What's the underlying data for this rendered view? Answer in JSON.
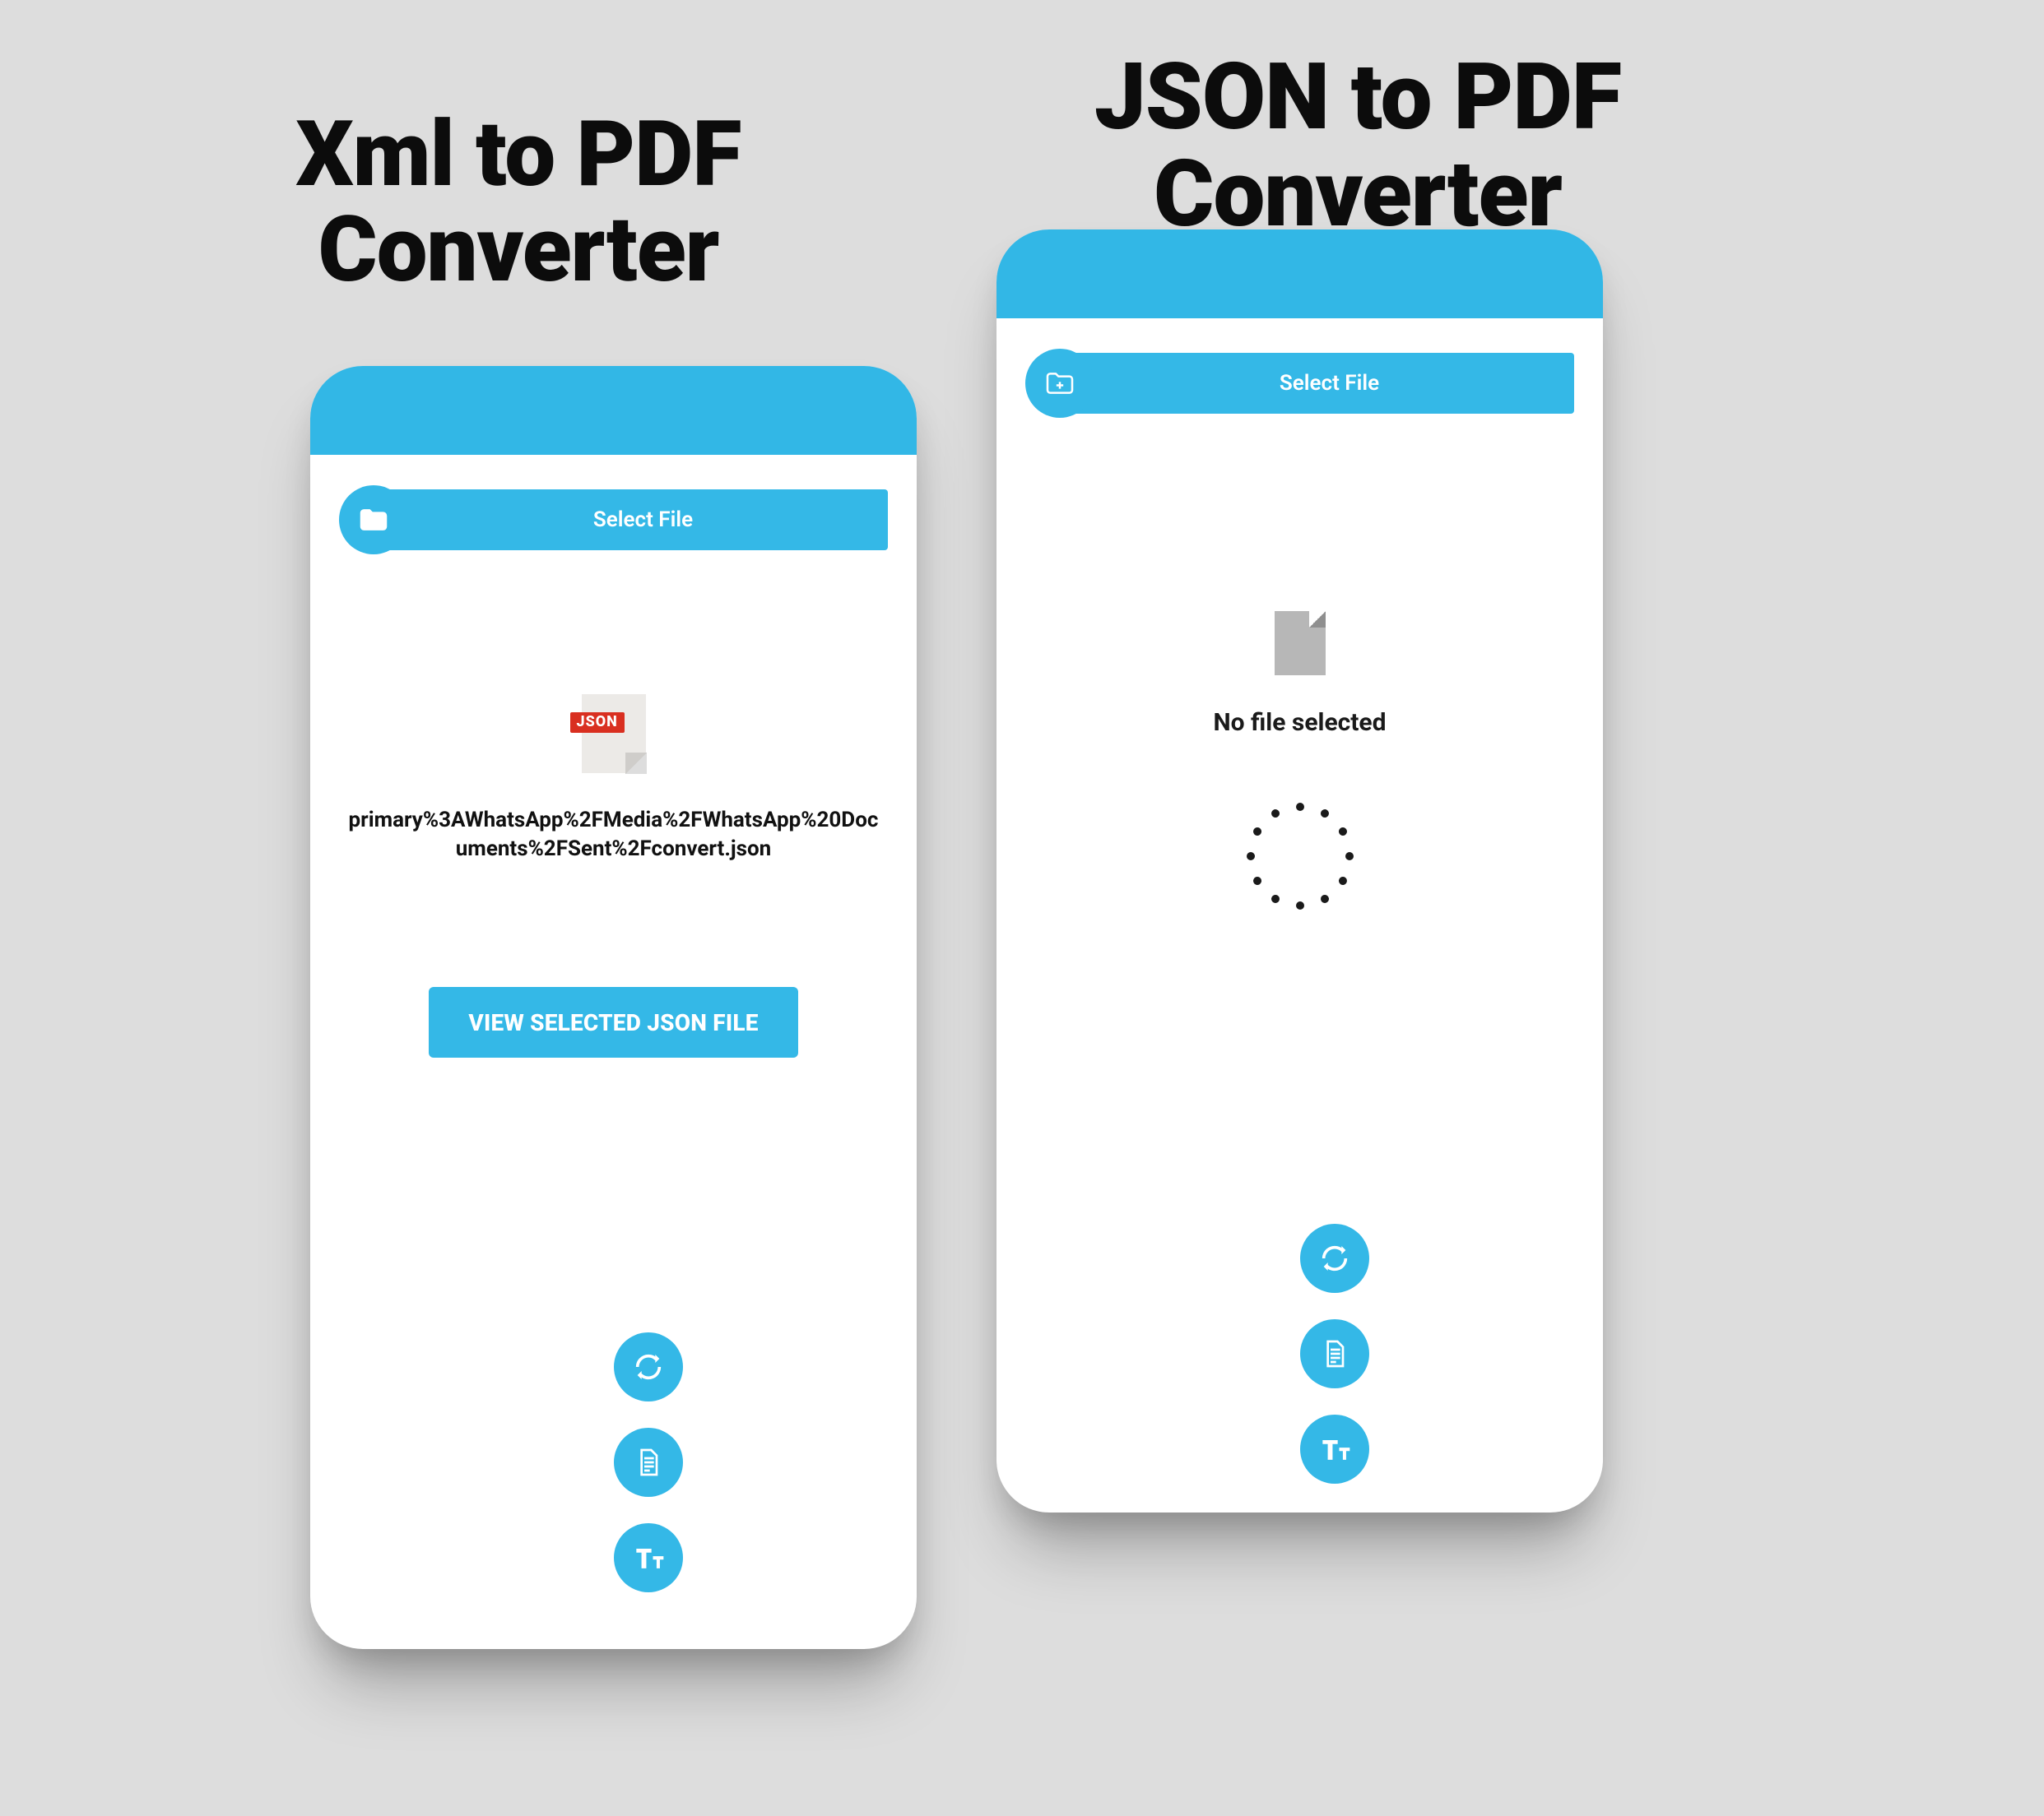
{
  "titles": {
    "left_line1": "Xml to PDF",
    "left_line2": "Converter",
    "right_line1": "JSON to PDF",
    "right_line2": "Converter"
  },
  "buttons": {
    "select_file": "Select File",
    "view_selected": "VIEW SELECTED JSON FILE",
    "convert": "CONVERT",
    "raw_convert": "RAW CONVERT",
    "text_format": "Text Format"
  },
  "left": {
    "file_tag": "JSON",
    "file_path": "primary%3AWhatsApp%2FMedia%2FWhatsApp%20Documents%2FSent%2Fconvert.json"
  },
  "right": {
    "no_file": "No file selected"
  }
}
